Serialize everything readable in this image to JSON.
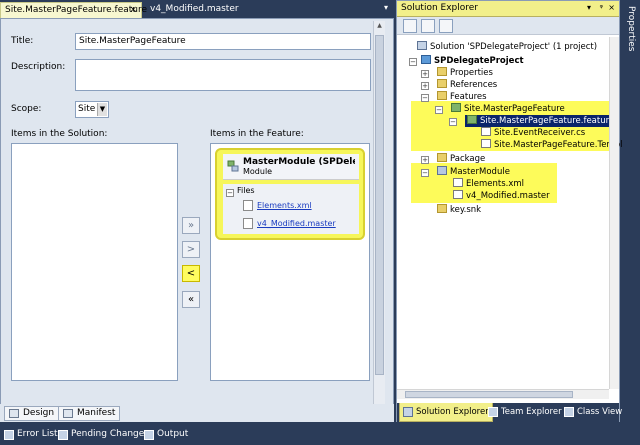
{
  "doc_tabs": {
    "active": "Site.MasterPageFeature.feature",
    "inactive": "v4_Modified.master",
    "close_glyph": "×",
    "dropdown_glyph": "▾"
  },
  "designer": {
    "title_label": "Title:",
    "title_value": "Site.MasterPageFeature",
    "description_label": "Description:",
    "description_value": "",
    "scope_label": "Scope:",
    "scope_value": "Site",
    "items_solution_label": "Items in the Solution:",
    "items_feature_label": "Items in the Feature:",
    "module": {
      "title": "MasterModule (SPDelegat...",
      "type": "Module",
      "files_label": "Files",
      "files": [
        "Elements.xml",
        "v4_Modified.master"
      ]
    },
    "buttons": {
      "add_all": "»",
      "add": ">",
      "remove": "<",
      "remove_all": "«"
    },
    "tabs": {
      "design": "Design",
      "manifest": "Manifest"
    }
  },
  "solution_explorer": {
    "title": "Solution Explorer",
    "pin_glyph": "▾",
    "pin2_glyph": "ᵠ",
    "close_glyph": "×",
    "tree": {
      "solution": "Solution 'SPDelegateProject' (1 project)",
      "project": "SPDelegateProject",
      "properties": "Properties",
      "references": "References",
      "features": "Features",
      "feature_folder": "Site.MasterPageFeature",
      "feature_file": "Site.MasterPageFeature.feature",
      "event_receiver": "Site.EventReceiver.cs",
      "template": "Site.MasterPageFeature.Template.",
      "package": "Package",
      "master_module": "MasterModule",
      "elements": "Elements.xml",
      "master": "v4_Modified.master",
      "key": "key.snk"
    },
    "bottom_tabs": [
      "Solution Explorer",
      "Team Explorer",
      "Class View"
    ]
  },
  "properties_strip": "Properties",
  "bottom_tabs": [
    "Error List",
    "Pending Changes",
    "Output"
  ],
  "colors": {
    "highlight": "#fdfb5a",
    "chrome": "#2b3c59",
    "designer_bg": "#dfe6ef"
  }
}
